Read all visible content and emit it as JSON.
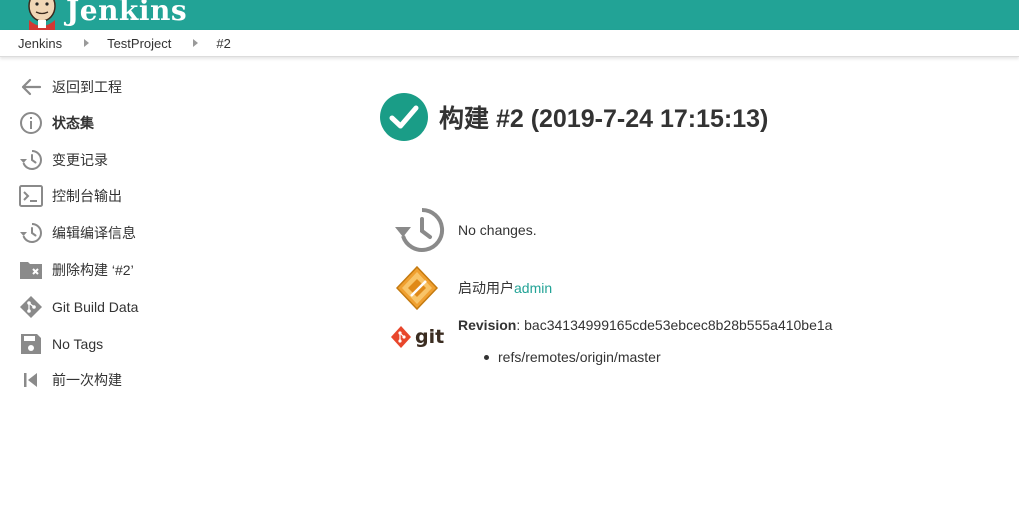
{
  "header": {
    "title": "Jenkins",
    "bg_color": "#22a396"
  },
  "breadcrumbs": [
    "Jenkins",
    "TestProject",
    "#2"
  ],
  "sidebar": {
    "items": [
      {
        "label": "返回到工程",
        "icon": "arrow-left-icon"
      },
      {
        "label": "状态集",
        "icon": "info-icon"
      },
      {
        "label": "变更记录",
        "icon": "history-icon"
      },
      {
        "label": "控制台输出",
        "icon": "terminal-icon"
      },
      {
        "label": "编辑编译信息",
        "icon": "history-icon"
      },
      {
        "label": "删除构建 ‘#2’",
        "icon": "folder-delete-icon"
      },
      {
        "label": "Git Build Data",
        "icon": "git-icon"
      },
      {
        "label": "No Tags",
        "icon": "save-icon"
      },
      {
        "label": "前一次构建",
        "icon": "skip-previous-icon"
      }
    ]
  },
  "build": {
    "title": "构建 #2 (2019-7-24 17:15:13)",
    "status_icon": "success-check-icon",
    "status_color": "#1a9d87",
    "changes_text": "No changes.",
    "started_by_prefix": "启动用户",
    "started_by_user": "admin",
    "revision_label": "Revision",
    "revision_sep": ": ",
    "revision_hash": "bac34134999165cde53ebcec8b28b555a410be1a",
    "refs": [
      "refs/remotes/origin/master"
    ],
    "git_logo_text": "git"
  }
}
